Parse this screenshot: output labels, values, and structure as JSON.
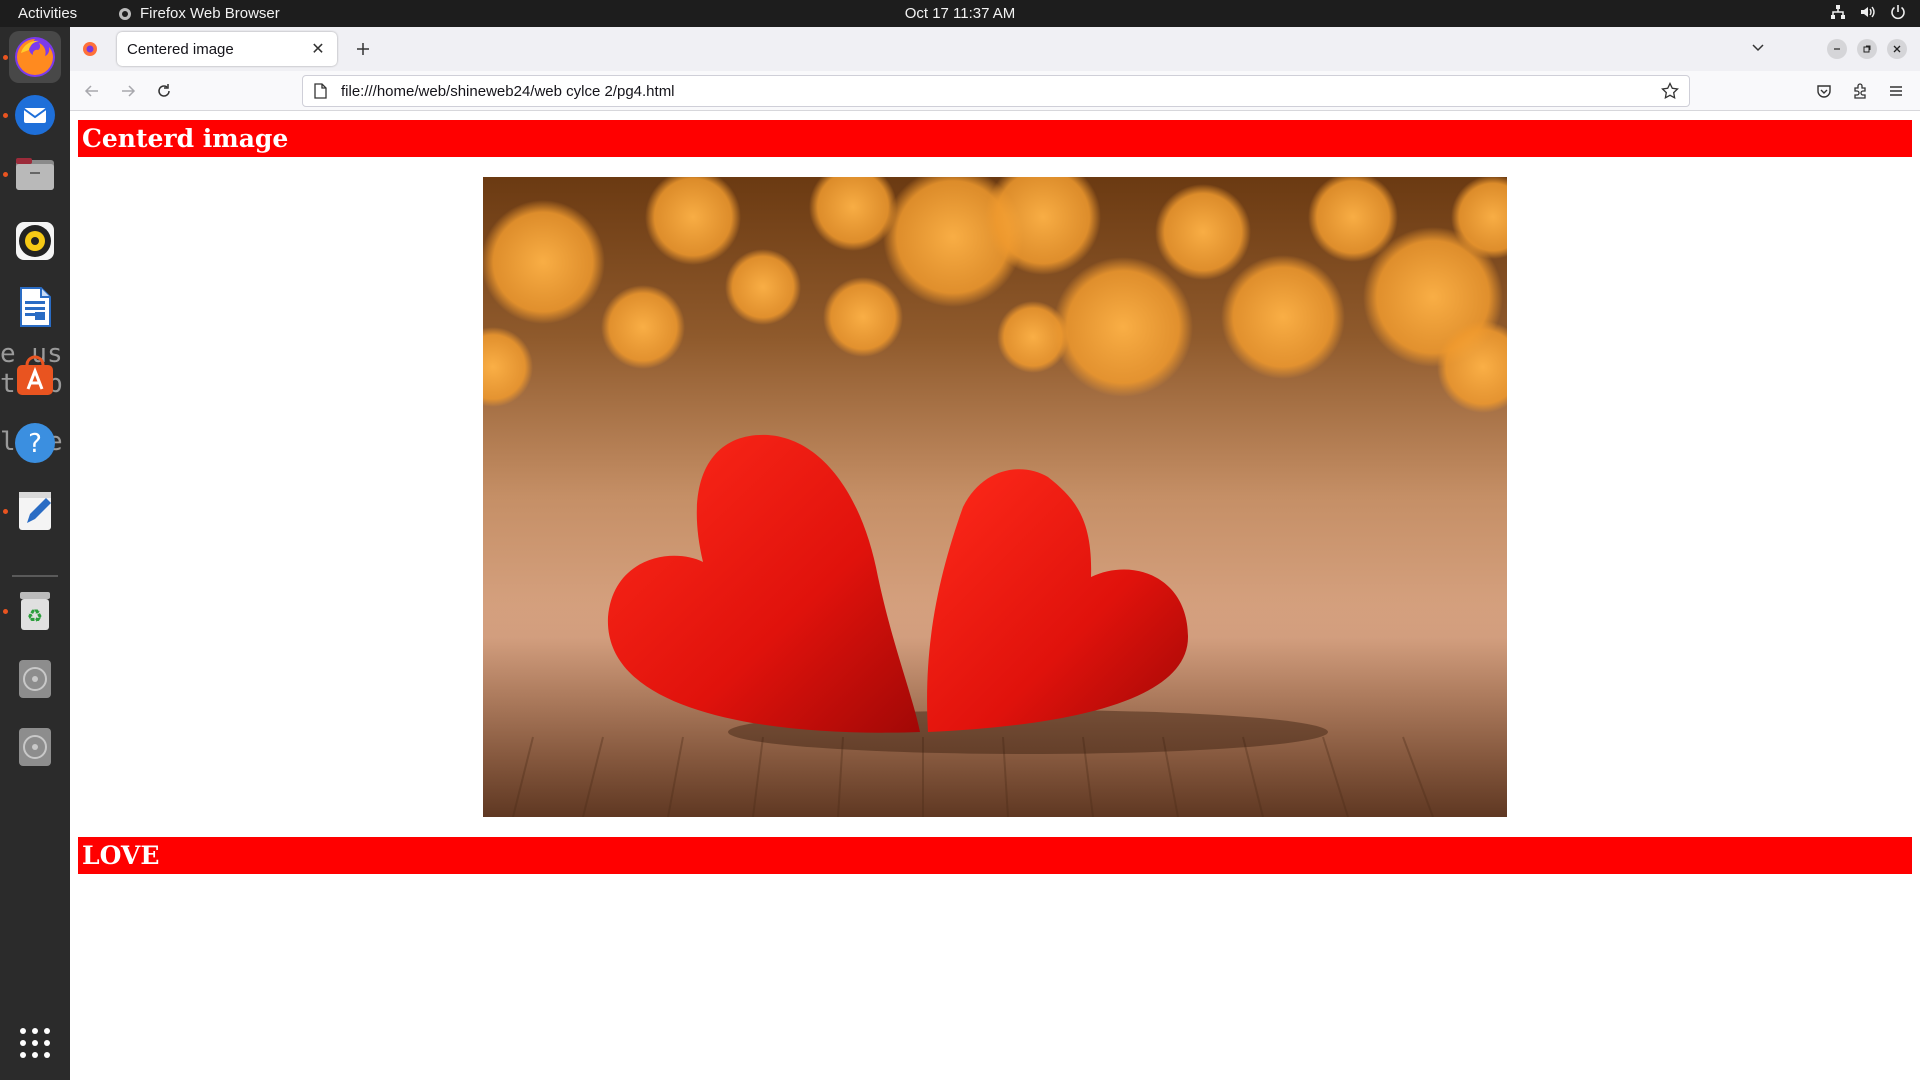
{
  "topbar": {
    "activities": "Activities",
    "app_name": "Firefox Web Browser",
    "clock": "Oct 17  11:37 AM"
  },
  "dock": {
    "items": [
      "firefox-icon",
      "thunderbird-icon",
      "files-icon",
      "rhythmbox-icon",
      "libreoffice-writer-icon",
      "app-center-icon",
      "help-icon",
      "text-editor-icon",
      "trash-icon",
      "disc-icon",
      "disc-icon"
    ],
    "background_text": [
      "e us",
      "th b",
      "late"
    ]
  },
  "browser": {
    "tab_title": "Centered image",
    "url": "file:///home/web/shineweb24/web cylce 2/pg4.html"
  },
  "page": {
    "heading1": "Centerd image",
    "heading2": "LOVE",
    "image": {
      "description_icon": "two-red-hearts-photo"
    }
  },
  "colors": {
    "heading_bg": "#ff0000",
    "heading_text": "#ffffff",
    "topbar_bg": "#1d1d1d",
    "dock_bg": "#2b2b2b",
    "accent": "#e95420"
  }
}
